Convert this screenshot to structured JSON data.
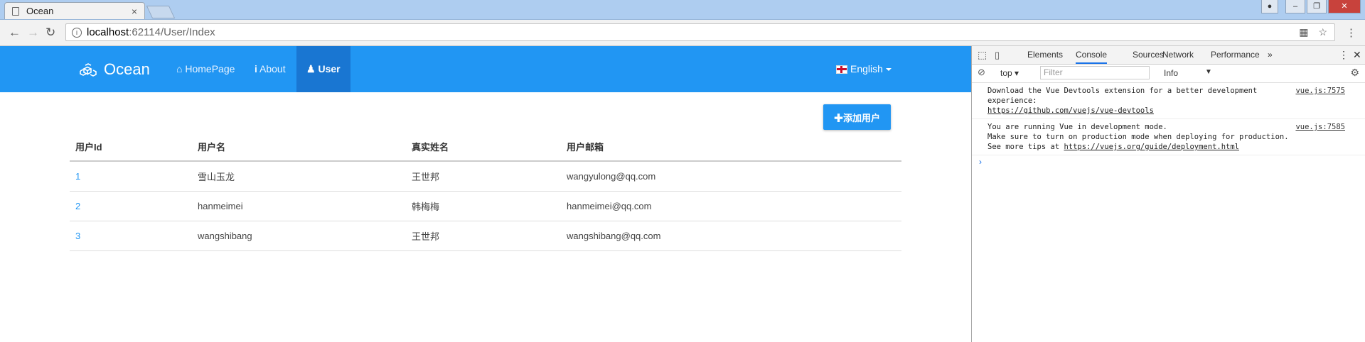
{
  "browser": {
    "tab_title": "Ocean",
    "tab_close": "×",
    "url_host": "localhost",
    "url_rest": ":62114/User/Index",
    "window_buttons": [
      "–",
      "❐",
      "✕"
    ]
  },
  "navbar": {
    "brand": "Ocean",
    "items": [
      {
        "label": "HomePage",
        "icon": "home-icon"
      },
      {
        "label": "About",
        "icon": "info-icon"
      },
      {
        "label": "User",
        "icon": "user-icon",
        "active": true
      }
    ],
    "language": "English"
  },
  "main": {
    "add_button": "✚添加用户",
    "table": {
      "headers": [
        "用户Id",
        "用户名",
        "真实姓名",
        "用户邮箱"
      ],
      "rows": [
        [
          "1",
          "雪山玉龙",
          "王世邦",
          "wangyulong@qq.com"
        ],
        [
          "2",
          "hanmeimei",
          "韩梅梅",
          "hanmeimei@qq.com"
        ],
        [
          "3",
          "wangshibang",
          "王世邦",
          "wangshibang@qq.com"
        ]
      ]
    }
  },
  "devtools": {
    "tabs": [
      "Elements",
      "Console",
      "Sources",
      "Network",
      "Performance",
      "»"
    ],
    "active_tab": "Console",
    "context": "top",
    "filter_placeholder": "Filter",
    "level": "Info",
    "messages": [
      {
        "text": "Download the Vue Devtools extension for a better development\nexperience:",
        "link": "https://github.com/vuejs/vue-devtools",
        "source": "vue.js:7575"
      },
      {
        "text": "You are running Vue in development mode.\nMake sure to turn on production mode when deploying for production.\nSee more tips at ",
        "link": "https://vuejs.org/guide/deployment.html",
        "source": "vue.js:7585"
      }
    ],
    "prompt": "›"
  },
  "colors": {
    "primary": "#2196f3",
    "active_nav": "#1976d2"
  }
}
